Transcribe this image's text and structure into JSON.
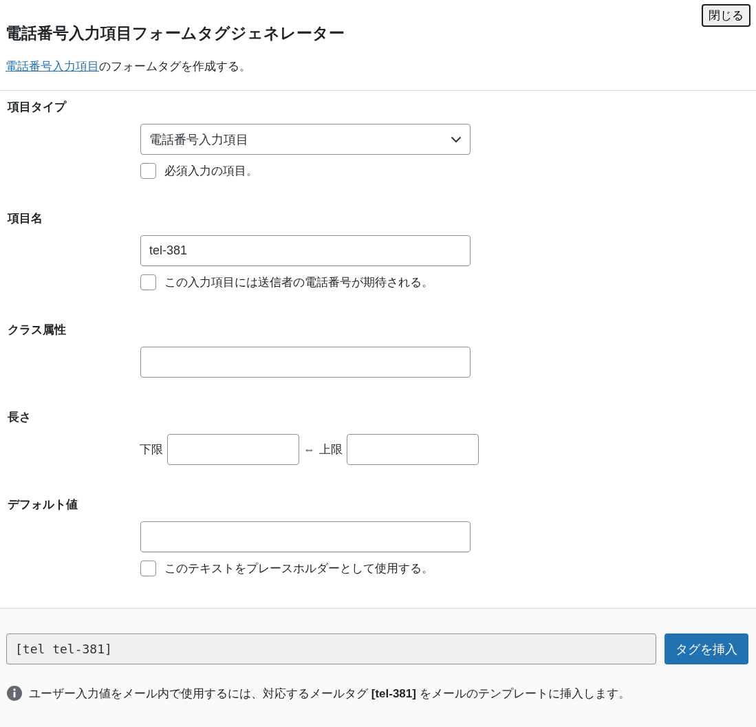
{
  "close_button": "閉じる",
  "title": "電話番号入力項目フォームタグジェネレーター",
  "description": {
    "link": "電話番号入力項目",
    "text": "のフォームタグを作成する。"
  },
  "fields": [
    {
      "kind": "select",
      "label": "項目タイプ",
      "value": "電話番号入力項目",
      "checkbox": {
        "label": "必須入力の項目。",
        "checked": false
      }
    },
    {
      "kind": "text",
      "label": "項目名",
      "value": "tel-381",
      "checkbox": {
        "label": "この入力項目には送信者の電話番号が期待される。",
        "checked": false
      }
    },
    {
      "kind": "text",
      "label": "クラス属性"
    },
    {
      "kind": "range",
      "label": "長さ",
      "min_label": "下限",
      "separator": "⇔",
      "max_label": "上限"
    },
    {
      "kind": "text",
      "label": "デフォルト値",
      "checkbox": {
        "label": "このテキストをプレースホルダーとして使用する。",
        "checked": false
      }
    }
  ],
  "footer": {
    "tag_code": "[tel tel-381]",
    "insert_button": "タグを挿入",
    "note": "ユーザー入力値をメール内で使用するには、対応するメールタグ **[tel-381]** をメールのテンプレートに挿入します。"
  }
}
